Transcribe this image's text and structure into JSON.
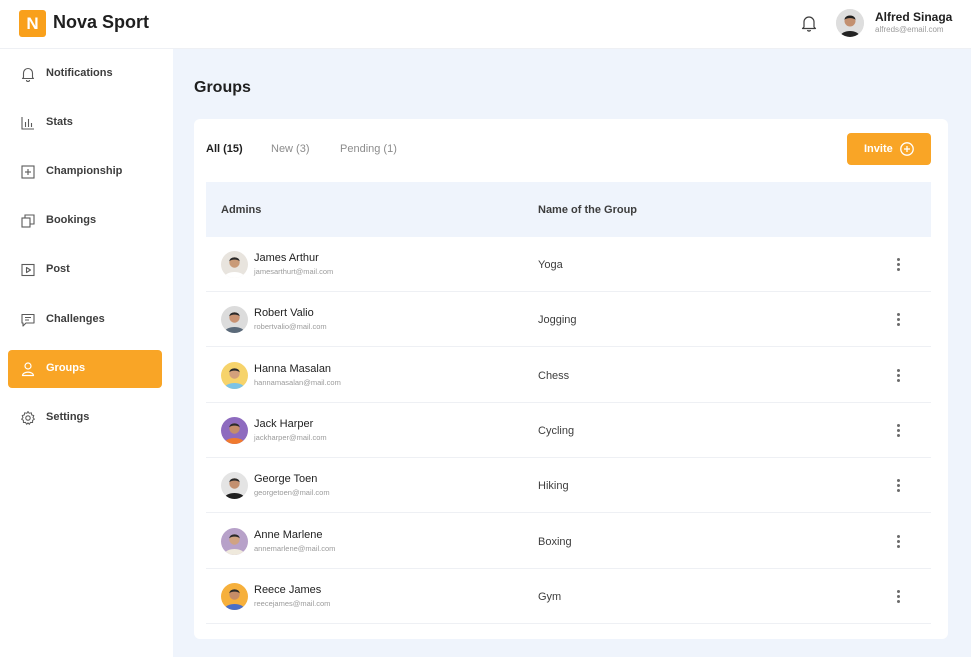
{
  "brand": {
    "letter": "N",
    "name": "Nova Sport",
    "accent": "#f9a526"
  },
  "user": {
    "name": "Alfred Sinaga",
    "email": "alfreds@email.com",
    "icon": "bell-icon"
  },
  "sidebar": {
    "items": [
      {
        "label": "Notifications",
        "icon": "bell-icon",
        "active": false
      },
      {
        "label": "Stats",
        "icon": "bar-chart-icon",
        "active": false
      },
      {
        "label": "Championship",
        "icon": "trophy-board-icon",
        "active": false
      },
      {
        "label": "Bookings",
        "icon": "copy-icon",
        "active": false
      },
      {
        "label": "Post",
        "icon": "play-icon",
        "active": false
      },
      {
        "label": "Challenges",
        "icon": "message-icon",
        "active": false
      },
      {
        "label": "Groups",
        "icon": "user-icon",
        "active": true
      },
      {
        "label": "Settings",
        "icon": "gear-icon",
        "active": false
      }
    ]
  },
  "main": {
    "title": "Groups",
    "tabs": [
      {
        "label": "All (15)",
        "active": true
      },
      {
        "label": "New (3)",
        "active": false
      },
      {
        "label": "Pending (1)",
        "active": false
      }
    ],
    "invite_label": "Invite",
    "table": {
      "headers": [
        "Admins",
        "Name of the Group"
      ],
      "rows": [
        {
          "name": "James Arthur",
          "email": "jamesarthurt@mail.com",
          "group": "Yoga",
          "avatar_bg": "#e8e4de",
          "shirt": "#ffffff",
          "skin": "#c99a77"
        },
        {
          "name": "Robert Valio",
          "email": "robertvalio@mail.com",
          "group": "Jogging",
          "avatar_bg": "#dcdcdc",
          "shirt": "#5b6a7a",
          "skin": "#c89272"
        },
        {
          "name": "Hanna Masalan",
          "email": "hannamasalan@mail.com",
          "group": "Chess",
          "avatar_bg": "#f6d36b",
          "shirt": "#7cc3e6",
          "skin": "#d3a07c"
        },
        {
          "name": "Jack Harper",
          "email": "jackharper@mail.com",
          "group": "Cycling",
          "avatar_bg": "#8e6bbf",
          "shirt": "#f07a2f",
          "skin": "#c48d6b"
        },
        {
          "name": "George Toen",
          "email": "georgetoen@mail.com",
          "group": "Hiking",
          "avatar_bg": "#e4e4e4",
          "shirt": "#1f1f1f",
          "skin": "#c39070"
        },
        {
          "name": "Anne Marlene",
          "email": "annemarlene@mail.com",
          "group": "Boxing",
          "avatar_bg": "#b7a1c9",
          "shirt": "#efe9dc",
          "skin": "#d0a382"
        },
        {
          "name": "Reece James",
          "email": "reecejames@mail.com",
          "group": "Gym",
          "avatar_bg": "#f6b03c",
          "shirt": "#4a6fc7",
          "skin": "#c58c68"
        }
      ]
    }
  }
}
